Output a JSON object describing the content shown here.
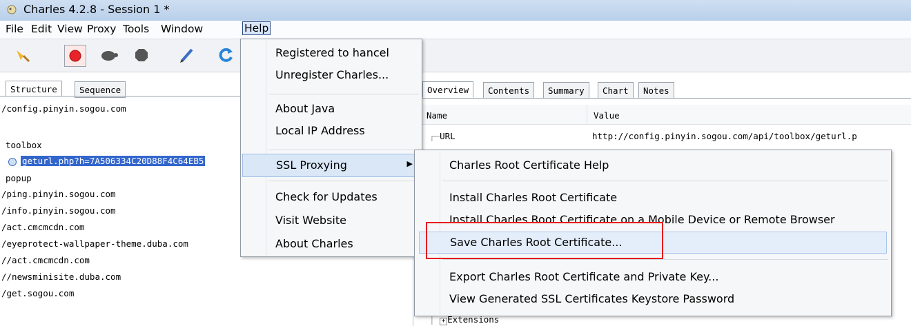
{
  "window": {
    "title": "Charles 4.2.8 - Session 1 *"
  },
  "menubar": {
    "items": [
      "File",
      "Edit",
      "View",
      "Proxy",
      "Tools",
      "Window",
      "Help"
    ]
  },
  "left": {
    "tabs": [
      "Structure",
      "Sequence"
    ],
    "tree": [
      "/config.pinyin.sogou.com",
      "toolbox",
      "geturl.php?h=7A506334C20D88F4C64EB5",
      "popup",
      "/ping.pinyin.sogou.com",
      "/info.pinyin.sogou.com",
      "/act.cmcmcdn.com",
      "/eyeprotect-wallpaper-theme.duba.com",
      "//act.cmcmcdn.com",
      "//newsminisite.duba.com",
      "/get.sogou.com"
    ]
  },
  "right": {
    "tabs": [
      "Overview",
      "Contents",
      "Summary",
      "Chart",
      "Notes"
    ],
    "columns": [
      "Name",
      "Value"
    ],
    "rows": [
      {
        "name": "URL",
        "value": "http://config.pinyin.sogou.com/api/toolbox/geturl.p"
      },
      {
        "name": "Extensions",
        "value": ""
      }
    ]
  },
  "help_menu": {
    "items": [
      "Registered to hancel",
      "Unregister Charles...",
      "About Java",
      "Local IP Address",
      "SSL Proxying",
      "Check for Updates",
      "Visit Website",
      "About Charles"
    ]
  },
  "ssl_submenu": {
    "items": [
      "Charles Root Certificate Help",
      "Install Charles Root Certificate",
      "Install Charles Root Certificate on a Mobile Device or Remote Browser",
      "Save Charles Root Certificate...",
      "Export Charles Root Certificate and Private Key...",
      "View Generated SSL Certificates Keystore Password"
    ]
  },
  "colors": {
    "record_red": "#e8232a",
    "refresh_blue": "#2a84d8",
    "highlight_red": "#e81c1c",
    "selection": "#3366cc"
  },
  "icons": [
    "broom-icon",
    "record-icon",
    "turtle-icon",
    "stop-icon",
    "pen-icon",
    "refresh-icon"
  ]
}
